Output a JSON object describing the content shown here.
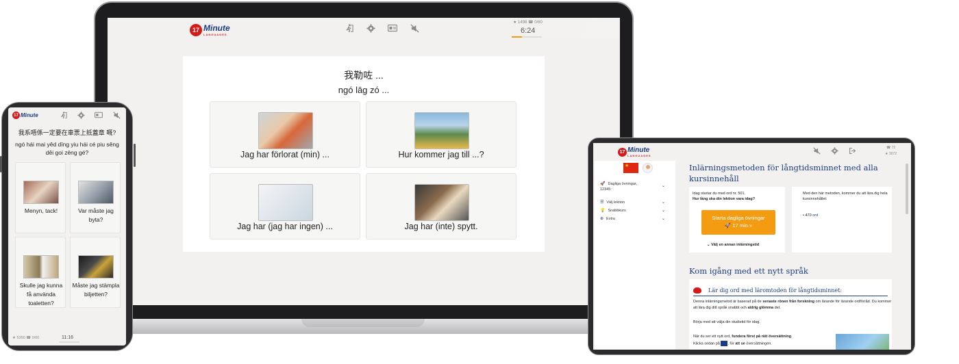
{
  "brand": {
    "number": "17",
    "name": "Minute",
    "tag": "LANGUAGES",
    "primary_color": "#1c3b85",
    "accent_color": "#d41b1b",
    "cta_color": "#f39c12"
  },
  "laptop": {
    "stats": "★ 1498 ☎ 0/60",
    "timer": "6:24",
    "progress": 0.35,
    "icons": [
      "figure-icon",
      "gear-icon",
      "card-icon",
      "no-audio-icon"
    ],
    "question": "我勒咗 ...",
    "question_romanization": "ngó lāg zó ...",
    "options": [
      {
        "label": "Jag har förlorat (min) ...",
        "image": "woman-glasses-photo"
      },
      {
        "label": "Hur kommer jag till ...?",
        "image": "tourist-binoculars-photo"
      },
      {
        "label": "Jag har (jag har ingen) ...",
        "image": "doctor-hands-photo"
      },
      {
        "label": "Jag har (inte) spytt.",
        "image": "car-sick-photo"
      }
    ]
  },
  "phone": {
    "question": "我系唔係一定要在車票上抵蓋章 嘅?",
    "question_romanization": "ngó hái mai yêd dīng yiu hái cé piu sêng dêi goi zēng gé?",
    "options": [
      {
        "label": "Menyn, tack!",
        "image": "restaurant-photo"
      },
      {
        "label": "Var måste jag byta?",
        "image": "station-people-photo"
      },
      {
        "label": "Skulle jag kunna få använda toaletten?",
        "image": "toilet-door-photo"
      },
      {
        "label": "Måste jag stämpla biljetten?",
        "image": "ticket-machine-photo"
      }
    ],
    "stats": "★ 5350 ☎ 0/60",
    "timer": "11:16"
  },
  "tablet": {
    "stat_top": "☎ 72",
    "stat_bottom": "★ 3072",
    "sidebar": {
      "items": [
        {
          "icon": "rocket-icon",
          "label": "Dagliga övningar, 12345:"
        },
        {
          "icon": "list-icon",
          "label": "Välj lektion"
        },
        {
          "icon": "lightbulb-icon",
          "label": "Snabbkurs"
        },
        {
          "icon": "globe-icon",
          "label": "Extra"
        }
      ]
    },
    "title": "Inlärningsmetoden för långtidsminnet med alla kursinnehåll",
    "left_box": {
      "line1": "Idag startar du med ord nr. 501.",
      "line2": "Hur lång ska din lektion vara idag?",
      "cta_line1": "Starta dagliga övningar",
      "cta_line2": "🚀 17 min »",
      "other_time": "⌄ Välj en annan inlärningstid"
    },
    "right_box": {
      "text": "Med den här metoden, kommer du att lära dig hela kursinnehållet:",
      "count": "470",
      "unit": "ord"
    },
    "section_title": "Kom igång med ett nytt språk",
    "learn_title": "Lär dig ord med läromtoden för långtidsminnet:",
    "p1_a": "Denna inlärningsmetod är baserad på de ",
    "p1_b": "senaste rönen från forskning",
    "p1_c": " om lärande för lärande ordförråd. Du kommer att lära dig ditt språk snabbt och ",
    "p1_d": "aldrig glömma",
    "p1_e": " det.",
    "p2": "Börja med att välja din studietid för idag.",
    "p3_a": "När du ser ett nytt ord, ",
    "p3_b": "fundera först på rätt översättning",
    "p3_c": ".",
    "p4_a": "Klicka sedan på ",
    "p4_b": ", för ",
    "p4_c": "att se",
    "p4_d": " översättningen."
  }
}
